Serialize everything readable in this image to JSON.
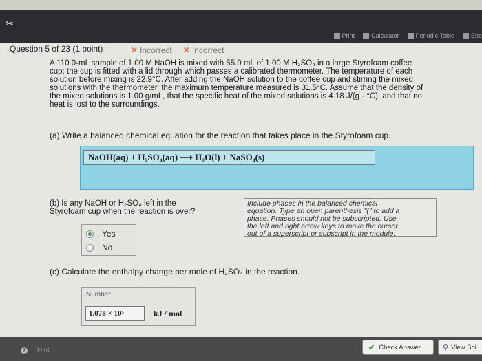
{
  "toolbar": {
    "print": "Print",
    "calculator": "Calculator",
    "periodic_table": "Periodic Table",
    "ebook": "Ebo"
  },
  "question": {
    "header": "Question 5 of 23 (1 point)",
    "marks": [
      "Incorrect",
      "Incorrect"
    ],
    "problem_lines": [
      "A 110.0-mL sample of 1.00 M NaOH is mixed with 55.0 mL of 1.00 M H₂SO₄ in a large Styrofoam coffee",
      "cup; the cup is fitted with a lid through which passes a calibrated thermometer. The temperature of each",
      "solution before mixing is 22.9°C. After adding the NaOH solution to the coffee cup and stirring the mixed",
      "solutions with the thermometer, the maximum temperature measured is 31.5°C. Assume that the density of",
      "the mixed solutions is 1.00 g/mL, that the specific heat of the mixed solutions is 4.18 J/(g · °C), and that no",
      "heat is lost to the surroundings."
    ]
  },
  "part_a": {
    "prompt": "(a) Write a balanced chemical equation for the reaction that takes place in the Styrofoam cup.",
    "equation": "NaOH(aq)  +  H₂SO₄(aq)  ⟶  H₂O(l)  +  NaSO₄(s)"
  },
  "part_b": {
    "prompt_lines": [
      "(b) Is any NaOH or H₂SO₄ left in the",
      "Styrofoam cup when the reaction is over?"
    ],
    "options": [
      "Yes",
      "No"
    ],
    "selected": "Yes",
    "note_lines": [
      "Include phases in the balanced chemical",
      "equation. Type an open parenthesis \"(\" to add a",
      "phase. Phases should not be subscripted. Use",
      "the left and right arrow keys to move the cursor",
      "out of a superscript or subscript in the module."
    ]
  },
  "part_c": {
    "prompt": "(c) Calculate the enthalpy change per mole of H₂SO₄ in the reaction.",
    "number_label": "Number",
    "value": "1.078 × 10⁵",
    "unit": "kJ / mol"
  },
  "footer": {
    "hint": "Hint",
    "check_answer": "Check Answer",
    "view_solution": "View Sol"
  }
}
